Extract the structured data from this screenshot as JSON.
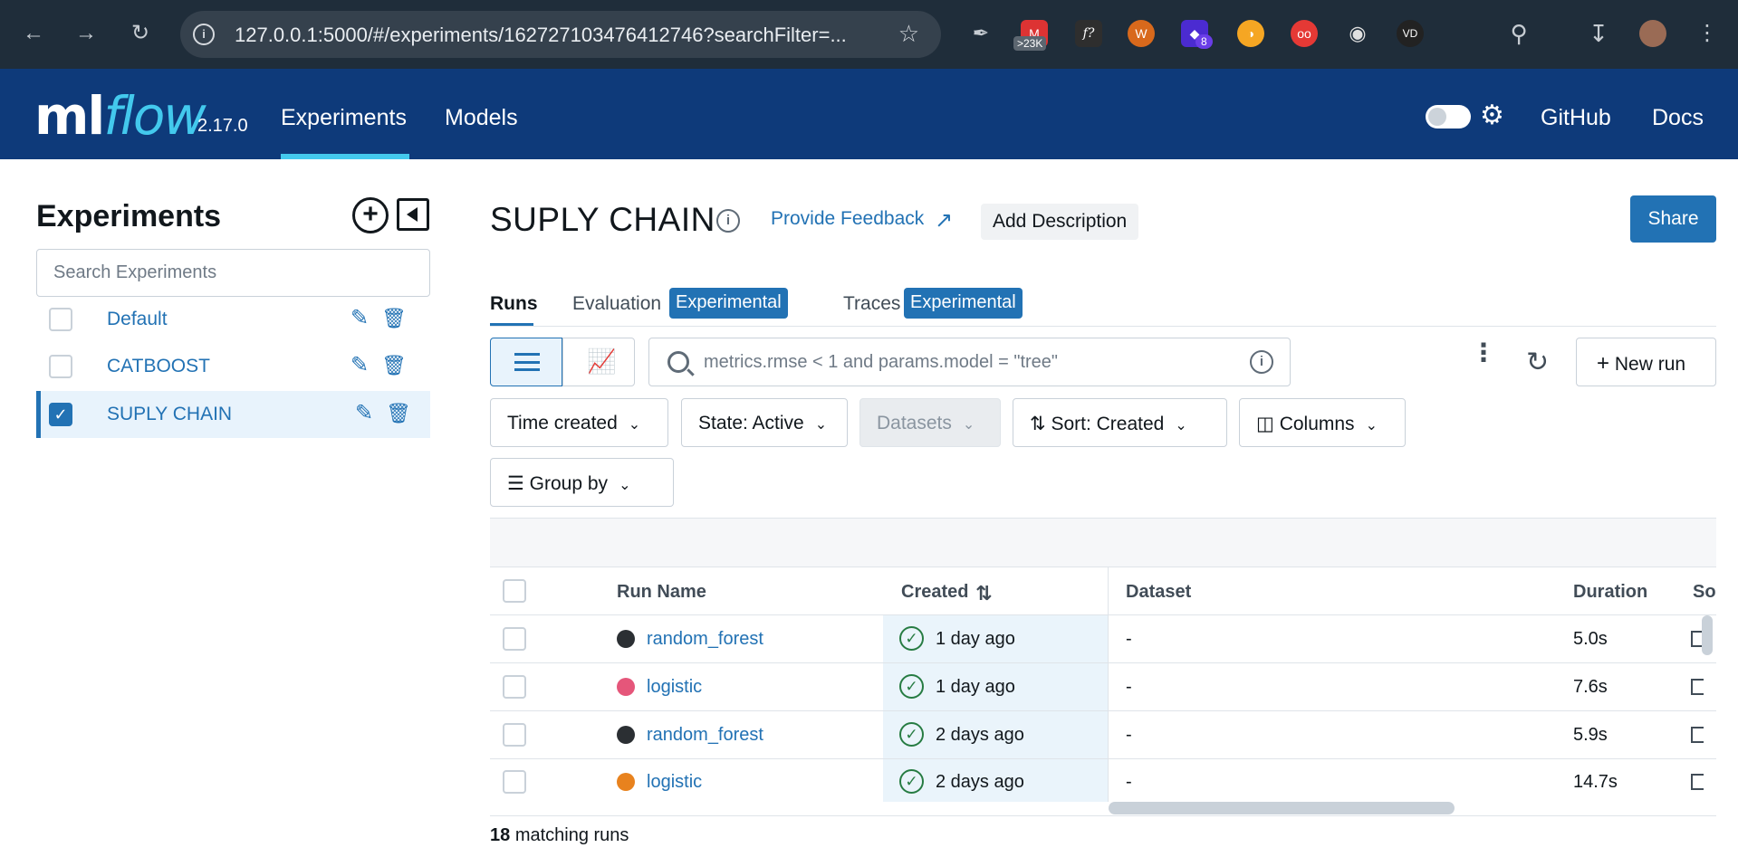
{
  "browser": {
    "url": "127.0.0.1:5000/#/experiments/162727103476412746?searchFilter=...",
    "ext_badge_gmail": ">23K",
    "ext_f": "f?",
    "ext_badge_count": "8",
    "ext_vd": "VD"
  },
  "header": {
    "logo_ml": "ml",
    "logo_flow": "flow",
    "version": "2.17.0",
    "nav": [
      "Experiments",
      "Models"
    ],
    "links": [
      "GitHub",
      "Docs"
    ]
  },
  "sidebar": {
    "title": "Experiments",
    "search_placeholder": "Search Experiments",
    "items": [
      {
        "label": "Default",
        "selected": false
      },
      {
        "label": "CATBOOST",
        "selected": false
      },
      {
        "label": "SUPLY CHAIN",
        "selected": true
      }
    ]
  },
  "main": {
    "title": "SUPLY CHAIN",
    "feedback": "Provide Feedback",
    "add_description": "Add Description",
    "share": "Share",
    "tabs": {
      "runs": "Runs",
      "evaluation": "Evaluation",
      "traces": "Traces",
      "badge": "Experimental"
    },
    "search_placeholder": "metrics.rmse < 1 and params.model = \"tree\"",
    "new_run": "New run",
    "filters": {
      "time": "Time created",
      "state": "State: Active",
      "datasets": "Datasets",
      "sort": "Sort: Created",
      "columns": "Columns",
      "group": "Group by"
    }
  },
  "table": {
    "headers": {
      "run_name": "Run Name",
      "created": "Created",
      "dataset": "Dataset",
      "duration": "Duration",
      "source": "Sou"
    },
    "rows": [
      {
        "name": "random_forest",
        "color": "#2b2f33",
        "created": "1 day ago",
        "dataset": "-",
        "duration": "5.0s"
      },
      {
        "name": "logistic",
        "color": "#e5567a",
        "created": "1 day ago",
        "dataset": "-",
        "duration": "7.6s"
      },
      {
        "name": "random_forest",
        "color": "#2b2f33",
        "created": "2 days ago",
        "dataset": "-",
        "duration": "5.9s"
      },
      {
        "name": "logistic",
        "color": "#e8821e",
        "created": "2 days ago",
        "dataset": "-",
        "duration": "14.7s"
      }
    ],
    "matching_count": "18",
    "matching_label": "matching runs"
  },
  "colors": {
    "accent": "#2272b4",
    "header_bg": "#0e3a7a",
    "logo_flow": "#43c9ed",
    "success": "#277c43"
  }
}
